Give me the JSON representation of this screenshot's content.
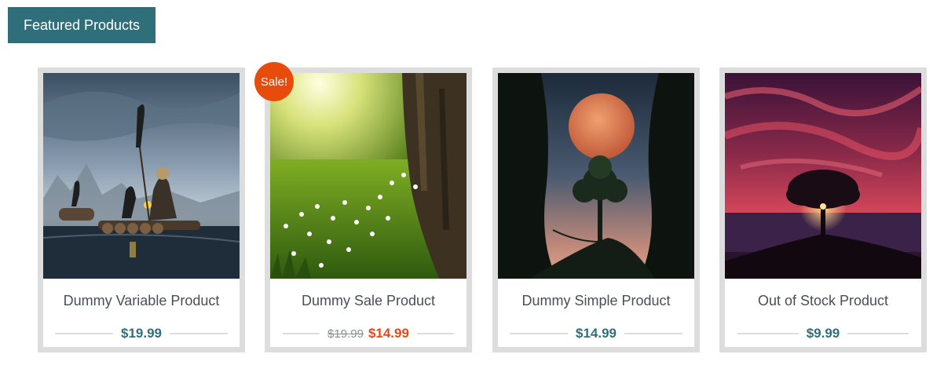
{
  "section": {
    "tab_label": "Featured Products"
  },
  "products": [
    {
      "title": "Dummy Variable Product",
      "price": "$19.99"
    },
    {
      "title": "Dummy Sale Product",
      "regular_price": "$19.99",
      "sale_price": "$14.99",
      "badge": "Sale!"
    },
    {
      "title": "Dummy Simple Product",
      "price": "$14.99"
    },
    {
      "title": "Out of Stock Product",
      "price": "$9.99"
    }
  ],
  "colors": {
    "accent": "#2f6f7a",
    "sale": "#e04b1a",
    "badge": "#e84c0c",
    "card_border": "#dddddd"
  }
}
